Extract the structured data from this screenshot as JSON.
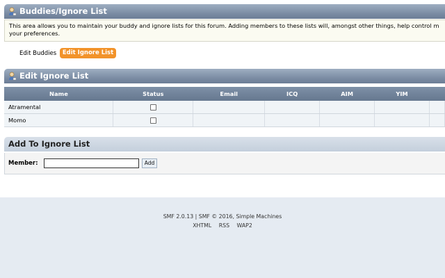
{
  "header": {
    "title": "Buddies/Ignore List"
  },
  "intro": {
    "line1": "This area allows you to maintain your buddy and ignore lists for this forum. Adding members to these lists will, amongst other things, help control m",
    "line2": "your preferences."
  },
  "tabs": {
    "buddies": "Edit Buddies",
    "ignore": "Edit Ignore List"
  },
  "ignore_section": {
    "title": "Edit Ignore List",
    "columns": [
      "Name",
      "Status",
      "Email",
      "ICQ",
      "AIM",
      "YIM"
    ],
    "rows": [
      {
        "name": "Atramental"
      },
      {
        "name": "Momo"
      }
    ]
  },
  "add_section": {
    "title": "Add To Ignore List",
    "member_label": "Member:",
    "input_value": "",
    "button": "Add"
  },
  "footer": {
    "copyright": "SMF 2.0.13 | SMF © 2016, Simple Machines",
    "links": [
      "XHTML",
      "RSS",
      "WAP2"
    ]
  },
  "colors": {
    "tab_active": "#f2932a",
    "header": "#7d8ea5"
  }
}
